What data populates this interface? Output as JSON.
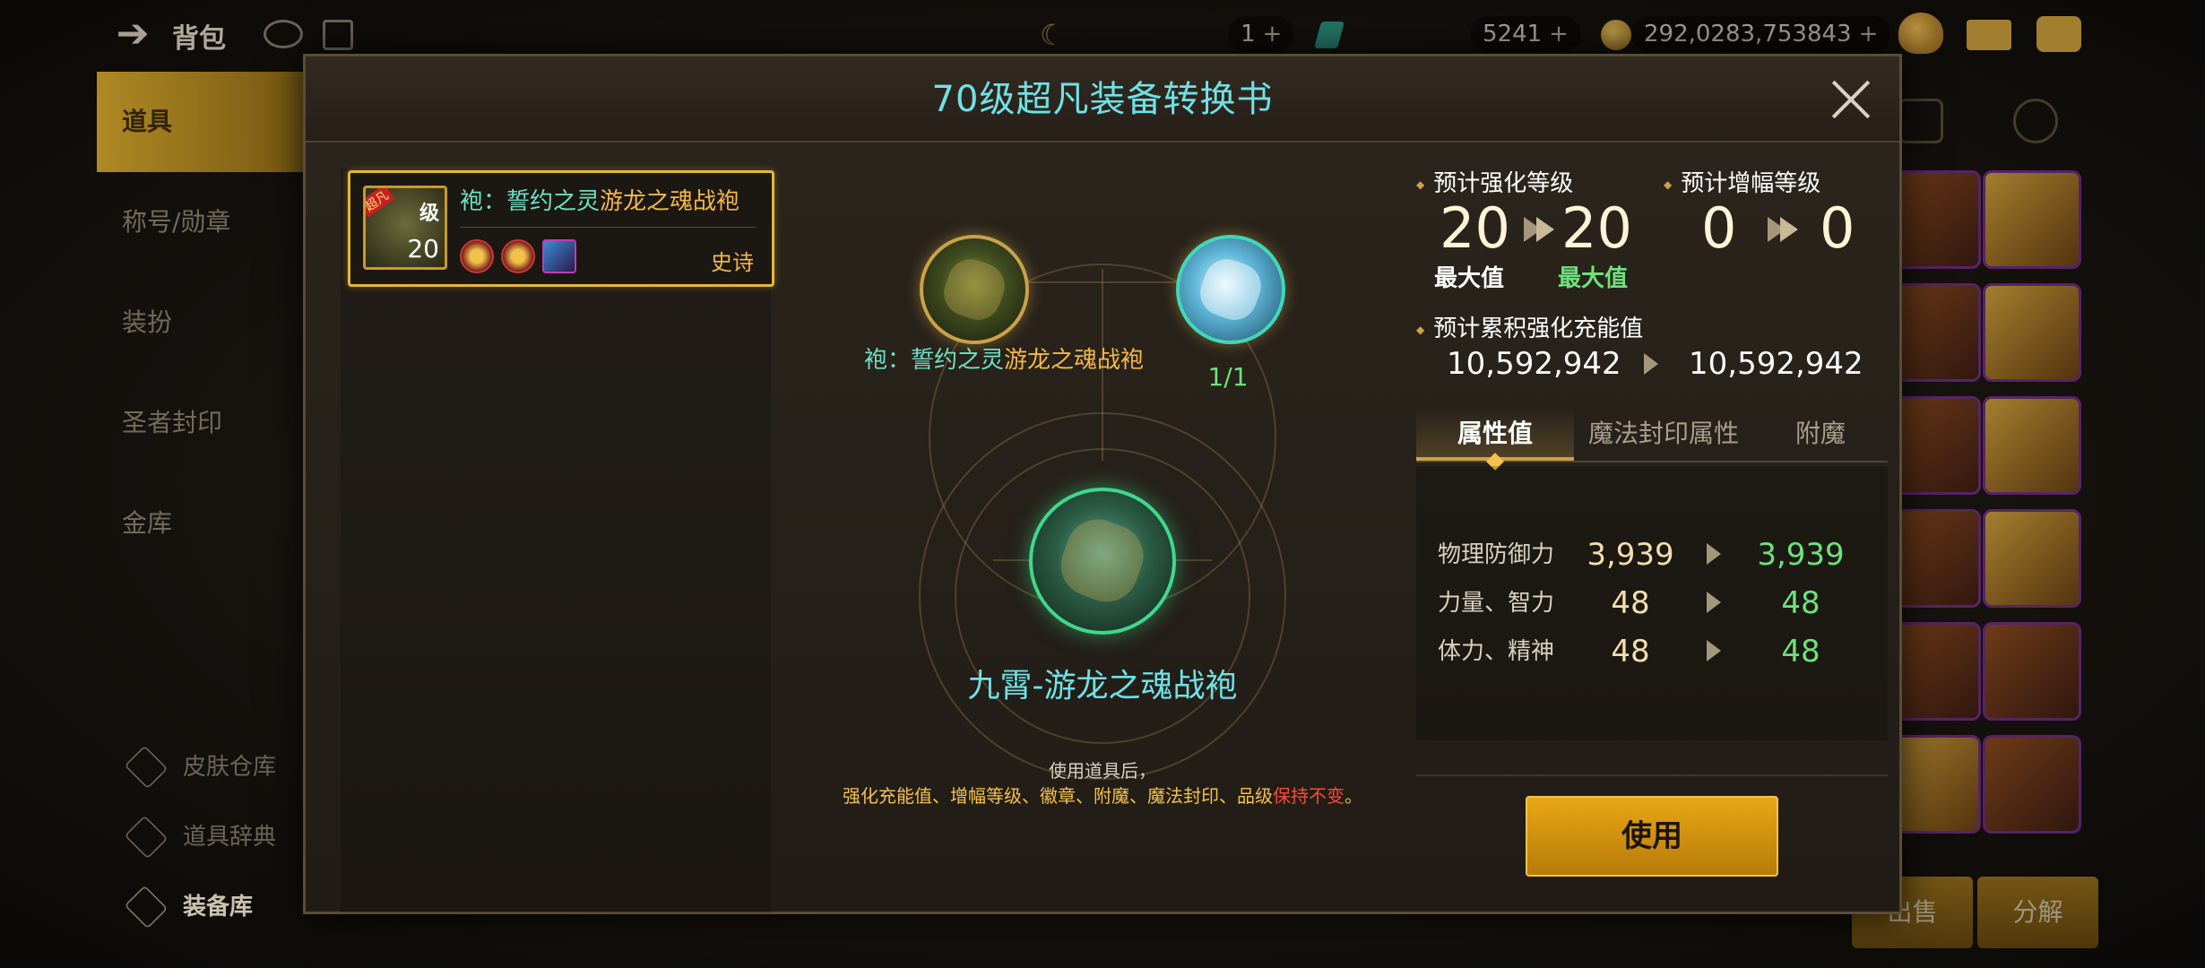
{
  "topbar": {
    "title": "背包",
    "currency1": {
      "value": "1",
      "plus": "+"
    },
    "currency2": {
      "value": "5241",
      "plus": "+"
    },
    "currency3": {
      "value": "292,0283,753843",
      "plus": "+"
    }
  },
  "sidebar": {
    "items": [
      {
        "label": "道具"
      },
      {
        "label": "称号/勋章"
      },
      {
        "label": "装扮"
      },
      {
        "label": "圣者封印"
      },
      {
        "label": "金库"
      }
    ],
    "links": [
      {
        "label": "皮肤仓库"
      },
      {
        "label": "道具辞典"
      },
      {
        "label": "装备库"
      }
    ]
  },
  "bottom_buttons": {
    "sell": "出售",
    "craft": "分解"
  },
  "modal": {
    "title": "70级超凡装备转换书",
    "item_card": {
      "name_prefix": "袍：誓约之灵",
      "name_suffix": "游龙之魂战袍",
      "rarity": "史诗",
      "thumb_tag": "超凡",
      "thumb_level": "级",
      "thumb_plus": "20"
    },
    "source": {
      "name_prefix": "袍：誓约之灵",
      "name_suffix": "游龙之魂战袍",
      "count": "1/1"
    },
    "result_name": "九霄-游龙之魂战袍",
    "note_line1": "使用道具后，",
    "note_line2_main": "强化充能值、增幅等级、徽章、附魔、魔法封印、品级",
    "note_line2_warn": "保持不变",
    "note_line2_end": "。",
    "enhance": {
      "label": "预计强化等级",
      "from": "20",
      "to": "20",
      "from_tag": "最大值",
      "to_tag": "最大值"
    },
    "amplify": {
      "label": "预计增幅等级",
      "from": "0",
      "to": "0"
    },
    "charge": {
      "label": "预计累积强化充能值",
      "from": "10,592,942",
      "to": "10,592,942"
    },
    "tabs": [
      "属性值",
      "魔法封印属性",
      "附魔"
    ],
    "attributes": [
      {
        "name": "物理防御力",
        "old": "3,939",
        "new": "3,939"
      },
      {
        "name": "力量、智力",
        "old": "48",
        "new": "48"
      },
      {
        "name": "体力、精神",
        "old": "48",
        "new": "48"
      }
    ],
    "use_button": "使用"
  },
  "colors": {
    "title_cyan": "#6fe1e6",
    "gold_accent": "#c9a24a",
    "green_value": "#6fe17a",
    "warn_red": "#ff4a3a",
    "button_gold": "#e9a716"
  }
}
